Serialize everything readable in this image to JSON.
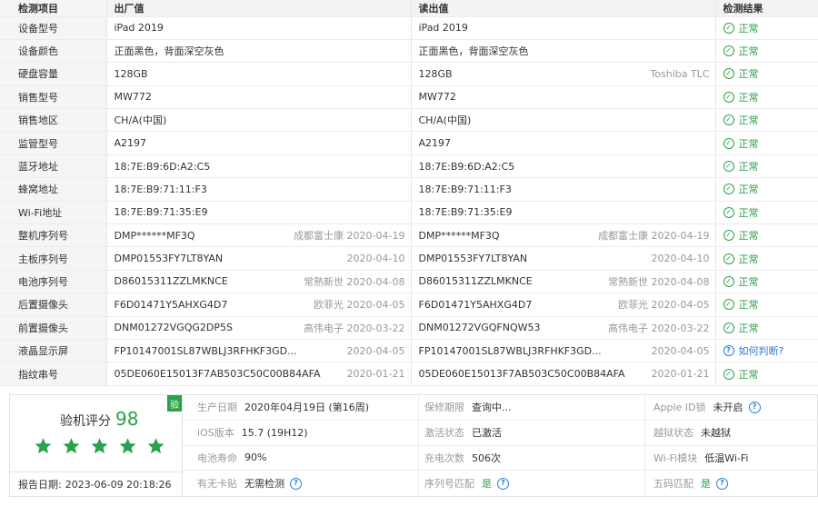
{
  "table": {
    "headers": {
      "item": "检测项目",
      "factory": "出厂值",
      "read": "读出值",
      "result": "检测结果"
    },
    "rows": [
      {
        "item": "设备型号",
        "factory": "iPad 2019",
        "factory_sub": "",
        "read": "iPad 2019",
        "read_sub": "",
        "result": "正常",
        "status": "ok"
      },
      {
        "item": "设备颜色",
        "factory": "正面黑色，背面深空灰色",
        "factory_sub": "",
        "read": "正面黑色，背面深空灰色",
        "read_sub": "",
        "result": "正常",
        "status": "ok"
      },
      {
        "item": "硬盘容量",
        "factory": "128GB",
        "factory_sub": "",
        "read": "128GB",
        "read_sub": "Toshiba TLC",
        "result": "正常",
        "status": "ok"
      },
      {
        "item": "销售型号",
        "factory": "MW772",
        "factory_sub": "",
        "read": "MW772",
        "read_sub": "",
        "result": "正常",
        "status": "ok"
      },
      {
        "item": "销售地区",
        "factory": "CH/A(中国)",
        "factory_sub": "",
        "read": "CH/A(中国)",
        "read_sub": "",
        "result": "正常",
        "status": "ok"
      },
      {
        "item": "监管型号",
        "factory": "A2197",
        "factory_sub": "",
        "read": "A2197",
        "read_sub": "",
        "result": "正常",
        "status": "ok"
      },
      {
        "item": "蓝牙地址",
        "factory": "18:7E:B9:6D:A2:C5",
        "factory_sub": "",
        "read": "18:7E:B9:6D:A2:C5",
        "read_sub": "",
        "result": "正常",
        "status": "ok"
      },
      {
        "item": "蜂窝地址",
        "factory": "18:7E:B9:71:11:F3",
        "factory_sub": "",
        "read": "18:7E:B9:71:11:F3",
        "read_sub": "",
        "result": "正常",
        "status": "ok"
      },
      {
        "item": "Wi-Fi地址",
        "factory": "18:7E:B9:71:35:E9",
        "factory_sub": "",
        "read": "18:7E:B9:71:35:E9",
        "read_sub": "",
        "result": "正常",
        "status": "ok"
      },
      {
        "item": "整机序列号",
        "factory": "DMP******MF3Q",
        "factory_sub": "成都富士康 2020-04-19",
        "read": "DMP******MF3Q",
        "read_sub": "成都富士康 2020-04-19",
        "result": "正常",
        "status": "ok"
      },
      {
        "item": "主板序列号",
        "factory": "DMP01553FY7LT8YAN",
        "factory_sub": "2020-04-10",
        "read": "DMP01553FY7LT8YAN",
        "read_sub": "2020-04-10",
        "result": "正常",
        "status": "ok"
      },
      {
        "item": "电池序列号",
        "factory": "D86015311ZZLMKNCE",
        "factory_sub": "常熟新世 2020-04-08",
        "read": "D86015311ZZLMKNCE",
        "read_sub": "常熟新世 2020-04-08",
        "result": "正常",
        "status": "ok"
      },
      {
        "item": "后置摄像头",
        "factory": "F6D01471Y5AHXG4D7",
        "factory_sub": "欧菲光 2020-04-05",
        "read": "F6D01471Y5AHXG4D7",
        "read_sub": "欧菲光 2020-04-05",
        "result": "正常",
        "status": "ok"
      },
      {
        "item": "前置摄像头",
        "factory": "DNM01272VGQG2DP5S",
        "factory_sub": "高伟电子 2020-03-22",
        "read": "DNM01272VGQFNQW53",
        "read_sub": "高伟电子 2020-03-22",
        "result": "正常",
        "status": "ok"
      },
      {
        "item": "液晶显示屏",
        "factory": "FP10147001SL87WBLJ3RFHKF3GD...",
        "factory_sub": "2020-04-05",
        "read": "FP10147001SL87WBLJ3RFHKF3GD...",
        "read_sub": "2020-04-05",
        "result": "如何判断?",
        "status": "query"
      },
      {
        "item": "指纹串号",
        "factory": "05DE060E15013F7AB503C50C00B84AFA",
        "factory_sub": "2020-01-21",
        "read": "05DE060E15013F7AB503C50C00B84AFA",
        "read_sub": "2020-01-21",
        "result": "正常",
        "status": "ok"
      }
    ]
  },
  "summary": {
    "score_label": "验机评分",
    "score": "98",
    "stars": 5,
    "badge": "验",
    "report_label": "报告日期:",
    "report_date": "2023-06-09 20:18:26",
    "info": [
      [
        {
          "key": "生产日期",
          "value": "2020年04月19日 (第16周)",
          "green": false,
          "help": false
        },
        {
          "key": "保修期限",
          "value": "查询中...",
          "green": false,
          "help": false
        },
        {
          "key": "Apple ID锁",
          "value": "未开启",
          "green": false,
          "help": true
        }
      ],
      [
        {
          "key": "iOS版本",
          "value": "15.7 (19H12)",
          "green": false,
          "help": false
        },
        {
          "key": "激活状态",
          "value": "已激活",
          "green": false,
          "help": false
        },
        {
          "key": "越狱状态",
          "value": "未越狱",
          "green": false,
          "help": false
        }
      ],
      [
        {
          "key": "电池寿命",
          "value": "90%",
          "green": false,
          "help": false
        },
        {
          "key": "充电次数",
          "value": "506次",
          "green": false,
          "help": false
        },
        {
          "key": "Wi-Fi模块",
          "value": "低温Wi-Fi",
          "green": false,
          "help": false
        }
      ],
      [
        {
          "key": "有无卡贴",
          "value": "无需检测",
          "green": false,
          "help": true
        },
        {
          "key": "序列号匹配",
          "value": "是",
          "green": true,
          "help": true
        },
        {
          "key": "五码匹配",
          "value": "是",
          "green": true,
          "help": true
        }
      ]
    ]
  },
  "colors": {
    "green": "#2aa24a",
    "blue": "#2f7bd9"
  }
}
